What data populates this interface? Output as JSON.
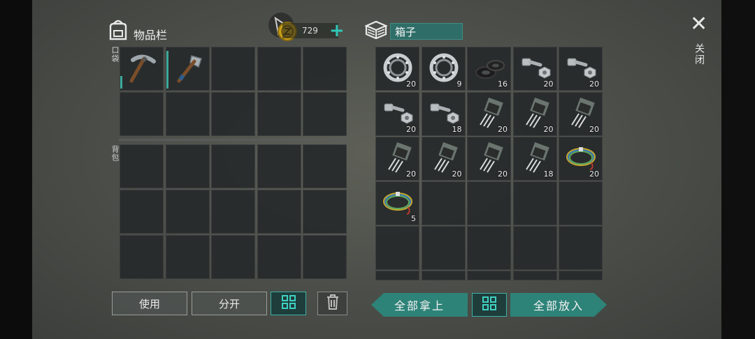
{
  "header": {
    "inventory_title": "物品栏",
    "coins": "729",
    "plus_label": "+",
    "container_title": "箱子",
    "close_icon": "✕",
    "close_label": "关闭"
  },
  "inventory": {
    "pocket_label": "口袋",
    "backpack_label": "背包",
    "pocket_items": [
      {
        "type": "pickaxe-icon",
        "durability_fraction": 0.3
      },
      {
        "type": "hatchet-icon",
        "durability_fraction": 0.9
      }
    ]
  },
  "container": {
    "items": [
      {
        "type": "bearing-icon",
        "qty": "20"
      },
      {
        "type": "bearing-icon",
        "qty": "9"
      },
      {
        "type": "rubber-seal-icon",
        "qty": "16"
      },
      {
        "type": "bolt-nut-icon",
        "qty": "20"
      },
      {
        "type": "bolt-nut-icon",
        "qty": "20"
      },
      {
        "type": "bolt-nut-icon",
        "qty": "20"
      },
      {
        "type": "bolt-nut-icon",
        "qty": "18"
      },
      {
        "type": "transistor-icon",
        "qty": "20"
      },
      {
        "type": "transistor-icon",
        "qty": "20"
      },
      {
        "type": "transistor-icon",
        "qty": "20"
      },
      {
        "type": "transistor-icon",
        "qty": "20"
      },
      {
        "type": "transistor-icon",
        "qty": "20"
      },
      {
        "type": "transistor-icon",
        "qty": "20"
      },
      {
        "type": "transistor-icon",
        "qty": "18"
      },
      {
        "type": "wire-coil-icon",
        "qty": "20"
      },
      {
        "type": "wire-coil-icon",
        "qty": "5"
      }
    ]
  },
  "actions": {
    "use_label": "使用",
    "split_label": "分开",
    "take_all_label": "全部拿上",
    "put_all_label": "全部放入"
  },
  "colors": {
    "accent_teal": "#2d8378",
    "slot_bg": "#26292a",
    "panel_bg": "#4e514b"
  }
}
